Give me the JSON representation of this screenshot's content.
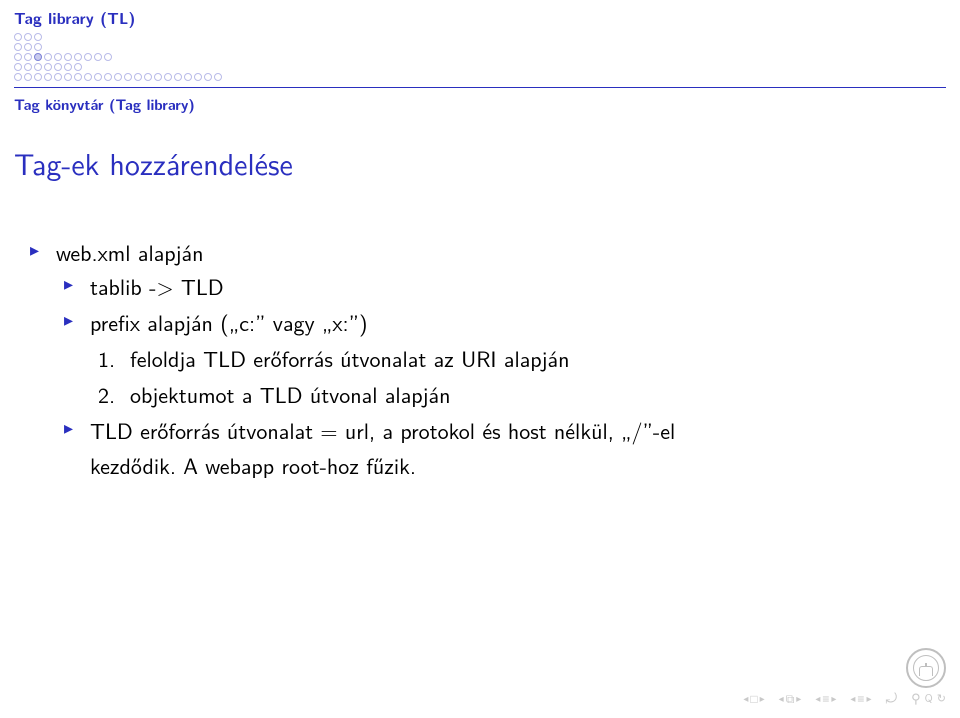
{
  "header": {
    "section": "Tag library (TL)",
    "subsection": "Tag könyvtár (Tag library)",
    "progress": {
      "rows": [
        {
          "count": 3,
          "filled": -1
        },
        {
          "count": 3,
          "filled": -1
        },
        {
          "count": 10,
          "filled": 2
        },
        {
          "count": 7,
          "filled": -1
        },
        {
          "count": 21,
          "filled": -1
        }
      ]
    }
  },
  "frame": {
    "title": "Tag-ek hozzárendelése"
  },
  "bullets": {
    "b1": "web.xml alapján",
    "b2": "tablib -> TLD",
    "b3": "prefix alapján („c:” vagy „x:”)",
    "e1": "feloldja TLD erőforrás útvonalat az URI alapján",
    "e2": "objektumot a TLD útvonal alapján",
    "b4a": "TLD erőforrás útvonalat = url, a protokol és host nélkül, „/”-el",
    "b4b": "kezdődik. A webapp root-hoz fűzik."
  },
  "nav": {
    "n1": "1.",
    "n2": "2."
  }
}
